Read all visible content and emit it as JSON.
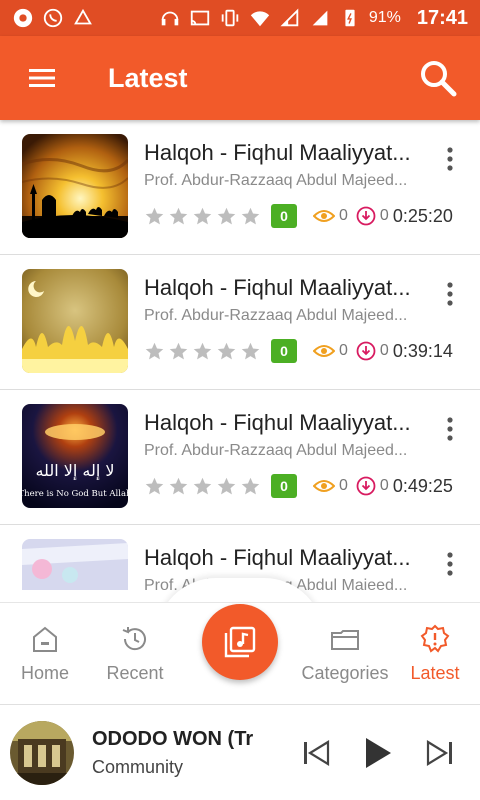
{
  "status_bar": {
    "battery": "91%",
    "time": "17:41"
  },
  "app_bar": {
    "title": "Latest"
  },
  "items": [
    {
      "title": "Halqoh - Fiqhul Maaliyyat...",
      "subtitle": "Prof. Abdur-Razzaaq Abdul Majeed...",
      "rating": "0",
      "views": "0",
      "downloads": "0",
      "duration": "0:25:20"
    },
    {
      "title": "Halqoh - Fiqhul Maaliyyat...",
      "subtitle": "Prof. Abdur-Razzaaq Abdul Majeed...",
      "rating": "0",
      "views": "0",
      "downloads": "0",
      "duration": "0:39:14"
    },
    {
      "title": "Halqoh - Fiqhul Maaliyyat...",
      "subtitle": "Prof. Abdur-Razzaaq Abdul Majeed...",
      "rating": "0",
      "views": "0",
      "downloads": "0",
      "duration": "0:49:25",
      "thumb_text_1": "لا إله إلا الله",
      "thumb_text_2": "There is No God But Allah"
    },
    {
      "title": "Halqoh - Fiqhul Maaliyyat...",
      "subtitle": "Prof. Abdur-Razzaaq Abdul Majeed..."
    }
  ],
  "bottom_nav": {
    "home": "Home",
    "recent": "Recent",
    "categories": "Categories",
    "latest": "Latest"
  },
  "player": {
    "title": "ODODO WON (Tr",
    "subtitle": "Community"
  },
  "colors": {
    "primary": "#f25a2a",
    "status": "#e04d24",
    "rating_badge": "#4caf24",
    "views_icon": "#f0a020",
    "download_icon": "#d81b60"
  }
}
